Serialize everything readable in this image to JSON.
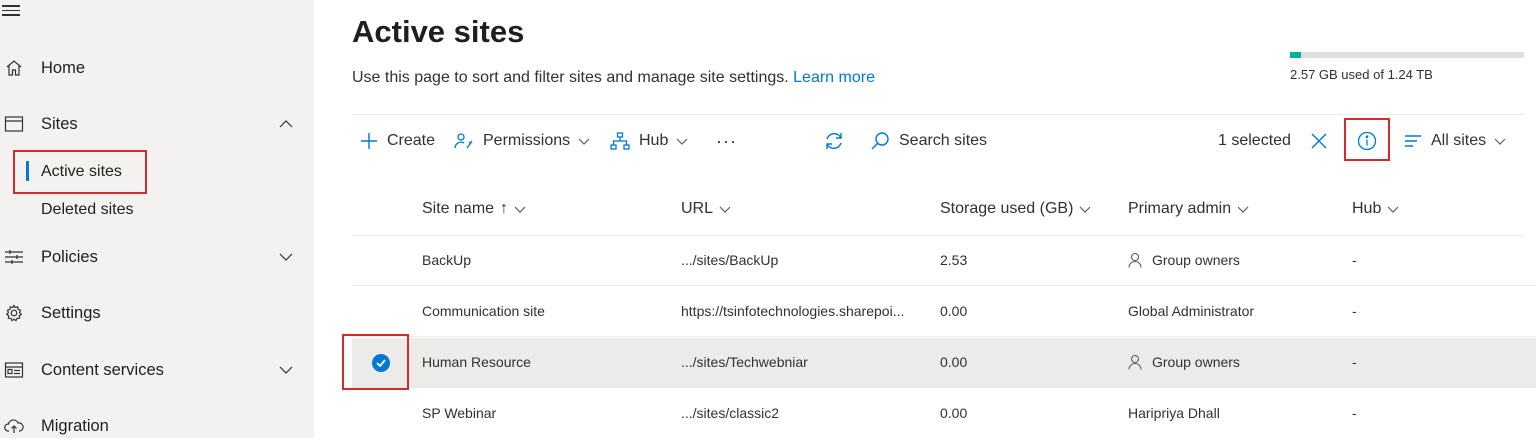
{
  "nav": {
    "items": [
      {
        "label": "Home",
        "icon": "home-icon"
      },
      {
        "label": "Sites",
        "icon": "browser-icon",
        "expanded": true
      },
      {
        "label": "Policies",
        "icon": "sliders-icon"
      },
      {
        "label": "Settings",
        "icon": "gear-icon"
      },
      {
        "label": "Content services",
        "icon": "content-icon"
      },
      {
        "label": "Migration",
        "icon": "cloud-upload-icon"
      }
    ],
    "sub_items": [
      {
        "label": "Active sites",
        "selected": true
      },
      {
        "label": "Deleted sites"
      }
    ]
  },
  "page": {
    "title": "Active sites",
    "description": "Use this page to sort and filter sites and manage site settings.",
    "learn_more": "Learn more"
  },
  "storage": {
    "text": "2.57 GB used of 1.24 TB",
    "fraction_used": 0.045,
    "color": "#00b294"
  },
  "toolbar": {
    "create": "Create",
    "permissions": "Permissions",
    "hub": "Hub",
    "more": "···",
    "search": "Search sites",
    "selected_count": "1 selected",
    "view": "All sites"
  },
  "table": {
    "columns": {
      "site_name": "Site name",
      "sort_arrow": "↑",
      "url": "URL",
      "storage": "Storage used (GB)",
      "admin": "Primary admin",
      "hub": "Hub"
    },
    "rows": [
      {
        "site_name": "BackUp",
        "url": ".../sites/BackUp",
        "storage": "2.53",
        "admin": "Group owners",
        "admin_group": true,
        "hub": "-",
        "selected": false
      },
      {
        "site_name": "Communication site",
        "url": "https://tsinfotechnologies.sharepoi...",
        "storage": "0.00",
        "admin": "Global Administrator",
        "admin_group": false,
        "hub": "-",
        "selected": false
      },
      {
        "site_name": "Human Resource",
        "url": ".../sites/Techwebniar",
        "storage": "0.00",
        "admin": "Group owners",
        "admin_group": true,
        "hub": "-",
        "selected": true
      },
      {
        "site_name": "SP Webinar",
        "url": ".../sites/classic2",
        "storage": "0.00",
        "admin": "Haripriya Dhall",
        "admin_group": false,
        "hub": "-",
        "selected": false
      }
    ]
  },
  "colors": {
    "accent": "#0078d4",
    "highlight_box": "#d52b2b",
    "sidebar_bg": "#f3f2f1"
  }
}
